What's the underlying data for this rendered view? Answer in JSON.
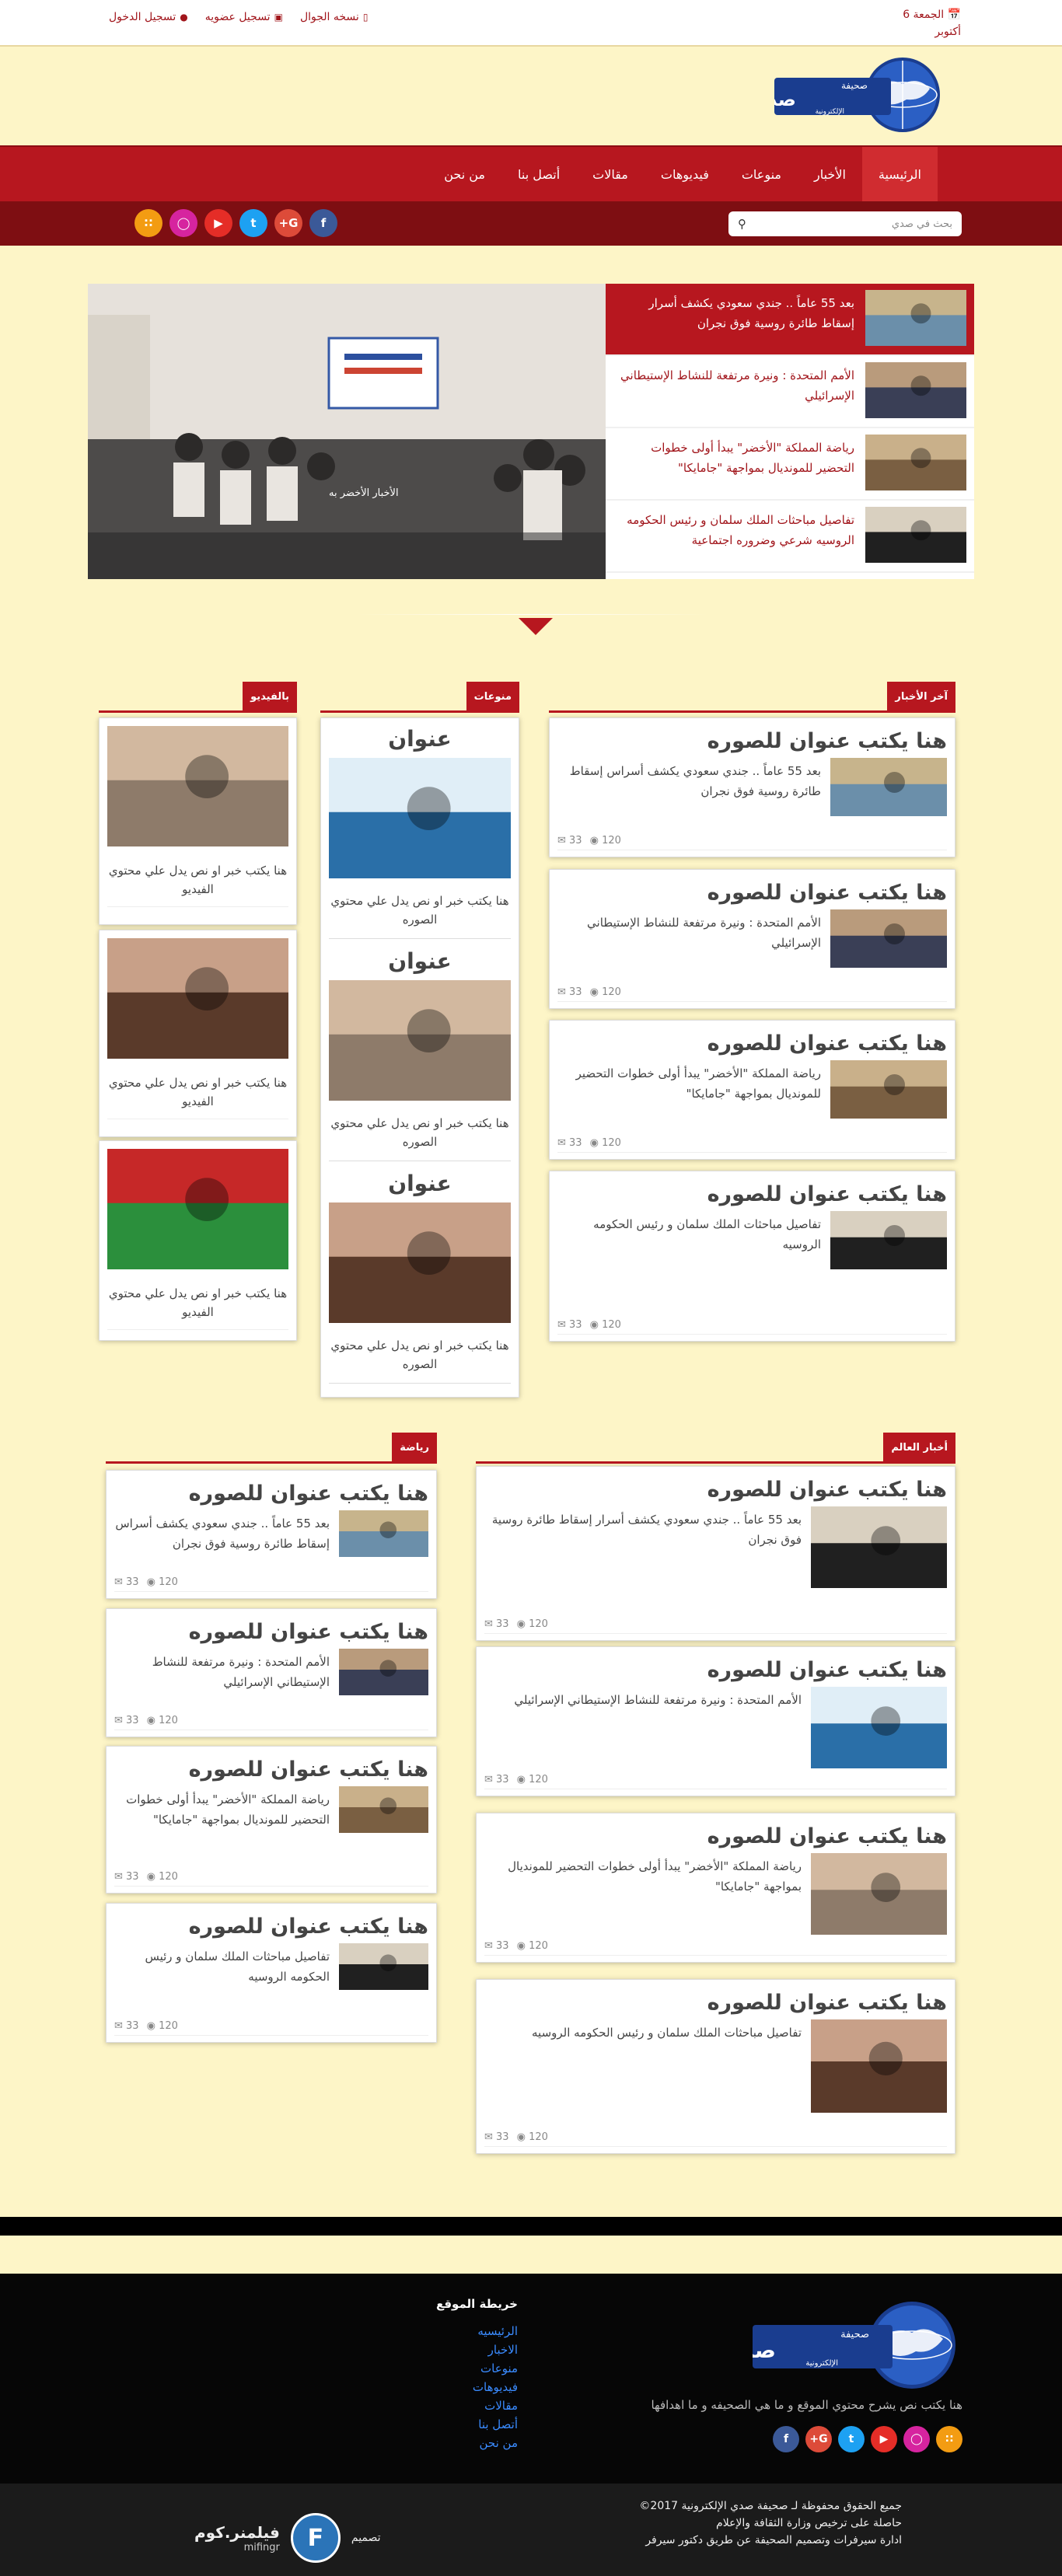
{
  "topbar": {
    "date": "الجمعة 6 أكتوبر",
    "login": "تسجيل الدخول",
    "register": "تسجيل عضويه",
    "mobile": "نسخه الجوال"
  },
  "logo": {
    "small": "صحيفة",
    "big": "صدى",
    "sub": "الإلكترونية"
  },
  "nav": {
    "items": [
      "الرئيسية",
      "الأخبار",
      "منوعات",
      "فيديوهات",
      "مقالات",
      "أتصل بنا",
      "من نحن"
    ]
  },
  "search": {
    "placeholder": "بحث في صدي"
  },
  "social": [
    "rss",
    "instagram",
    "youtube",
    "twitter",
    "google-plus",
    "facebook"
  ],
  "slider": {
    "caption": "الأخبار الأخضر به",
    "items": [
      "بعد 55 عاماً .. جندي سعودي يكشف أسرار إسقاط طائرة روسية فوق نجران",
      "الأمم المتحدة : ونيرة مرتفعة للنشاط الإستيطاني الإسرائيلي",
      "رياضة المملكة \"الأخضر\" يبدأ أولى خطوات التحضير للمونديال بمواجهة \"جامايكا\"",
      "تفاصيل مباحثات الملك سلمان و رئيس الحكومه الروسيه شرعي وضروره اجتماعية"
    ]
  },
  "sections": {
    "latest": "آخر الأخبار",
    "variety": "منوعات",
    "video": "بالفيديو",
    "world": "أخبار العالم",
    "sports": "رياضة"
  },
  "latest": [
    {
      "title": "هنا يكتب عنوان للصوره",
      "text": "بعد 55 عاماً .. جندي سعودي يكشف أسراس إسقاط طائرة روسية فوق نجران",
      "views": "120",
      "comments": "33"
    },
    {
      "title": "هنا يكتب عنوان للصوره",
      "text": "الأمم المتحدة : ونيرة مرتفعة للنشاط الإستيطاني الإسرائيلي",
      "views": "120",
      "comments": "33"
    },
    {
      "title": "هنا يكتب عنوان للصوره",
      "text": "رياضة المملكة \"الأخضر\" يبدأ أولى خطوات التحضير للمونديال بمواجهة \"جامايكا\"",
      "views": "120",
      "comments": "33"
    },
    {
      "title": "هنا يكتب عنوان للصوره",
      "text": "تفاصيل مباحثات الملك سلمان و رئيس الحكومه الروسيه",
      "views": "120",
      "comments": "33"
    }
  ],
  "variety": [
    {
      "title": "عنوان",
      "text": "هنا يكتب خبر او نص يدل علي محتوي الصوره"
    },
    {
      "title": "عنوان",
      "text": "هنا يكتب خبر او نص يدل علي محتوي الصوره"
    },
    {
      "title": "عنوان",
      "text": "هنا يكتب خبر او نص يدل علي محتوي الصوره"
    }
  ],
  "video": [
    {
      "text": "هنا يكتب خبر او نص يدل علي محتوي الفيديو"
    },
    {
      "text": "هنا يكتب خبر او نص يدل علي محتوي الفيديو"
    },
    {
      "text": "هنا يكتب خبر او نص يدل علي محتوي الفيديو"
    }
  ],
  "world": [
    {
      "title": "هنا يكتب عنوان للصوره",
      "text": "بعد 55 عاماً .. جندي سعودي يكشف أسرار إسقاط طائرة روسية فوق نجران",
      "views": "120",
      "comments": "33"
    },
    {
      "title": "هنا يكتب عنوان للصوره",
      "text": "الأمم المتحدة : ونيرة مرتفعة للنشاط الإستيطاني الإسرائيلي",
      "views": "120",
      "comments": "33"
    },
    {
      "title": "هنا يكتب عنوان للصوره",
      "text": "رياضة المملكة \"الأخضر\" يبدأ أولى خطوات التحضير للمونديال بمواجهة \"جامايكا\"",
      "views": "120",
      "comments": "33"
    },
    {
      "title": "هنا يكتب عنوان للصوره",
      "text": "تفاصيل مباحثات الملك سلمان و رئيس الحكومه الروسيه",
      "views": "120",
      "comments": "33"
    }
  ],
  "sports": [
    {
      "title": "هنا يكتب عنوان للصوره",
      "text": "بعد 55 عاماً .. جندي سعودي يكشف أسراس إسقاط طائرة روسية فوق نجران",
      "views": "120",
      "comments": "33"
    },
    {
      "title": "هنا يكتب عنوان للصوره",
      "text": "الأمم المتحدة : ونيرة مرتفعة للنشاط الإستيطاني الإسرائيلي",
      "views": "120",
      "comments": "33"
    },
    {
      "title": "هنا يكتب عنوان للصوره",
      "text": "رياضة المملكة \"الأخضر\" يبدأ أولى خطوات التحضير للمونديال بمواجهة \"جامايكا\"",
      "views": "120",
      "comments": "33"
    },
    {
      "title": "هنا يكتب عنوان للصوره",
      "text": "تفاصيل مباحثات الملك سلمان و رئيس الحكومه الروسيه",
      "views": "120",
      "comments": "33"
    }
  ],
  "footer": {
    "about": "هنا يكتب نص يشرح محتوي الموقع و ما هي الصحيفه و ما اهدافها",
    "sitemap_title": "خريطة الموقع",
    "sitemap": [
      "الرئيسيه",
      "الاخبار",
      "منوعات",
      "فيديوهات",
      "مقالات",
      "أتصل بنا",
      "من نحن"
    ],
    "copy1": "جميع الحقوق محفوظة لـ صحيفة صدي الإلكترونية 2017©",
    "copy2": "حاصلة على ترخيص وزارة الثقافة والإعلام",
    "copy3": "ادارة سيرفرات وتصميم الصحيفة عن طريق دكتور سيرفر",
    "design_label": "تصميم",
    "designer": "فيلمنر.كوم",
    "designer_en": "mifingr"
  },
  "colors": {
    "brand": "#b7171f",
    "bg": "#fdf5c7"
  }
}
